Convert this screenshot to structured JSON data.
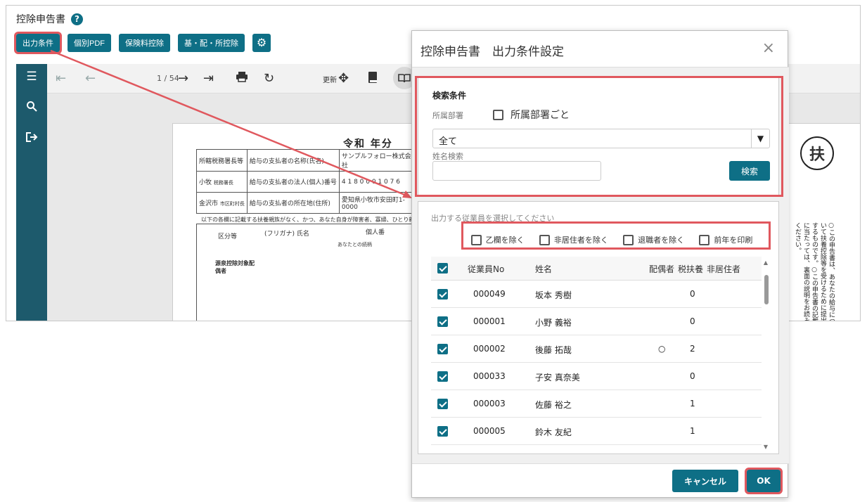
{
  "app": {
    "title": "控除申告書"
  },
  "toolbar": {
    "output_conditions": "出力条件",
    "individual_pdf": "個別PDF",
    "insurance_deduction": "保険料控除",
    "basic_spouse_deduction": "基・配・所控除"
  },
  "viewer": {
    "page_indicator": "1 / 54",
    "refresh_label": "更新"
  },
  "document": {
    "title": "令和 年分",
    "office_label": "所轄税務署長等",
    "tax_office": "小牧",
    "tax_office_suffix": "税務署長",
    "payer_name_label": "給与の支払者の名称(氏名)",
    "payer_name": "サンプルフォロー株式会社",
    "payer_number_label": "給与の支払者の法人(個人)番号",
    "payer_number": "4 1 8 0 0 0 1 0 7 6",
    "city": "金沢市",
    "city_suffix": "市区町村長",
    "payer_address_label": "給与の支払者の所在地(住所)",
    "payer_address": "愛知県小牧市安田町1-0000",
    "note": "以下の各欄に記載する扶養親族がなく、かつ、あなた自身が障害者、寡婦、ひとり親又",
    "class_label": "区分等",
    "furigana": "(フリガナ) 氏名",
    "personal_label": "個人番",
    "relation_label": "あなたとの続柄",
    "spouse_label": "源泉控除対象配偶者",
    "fu": "扶",
    "side_note": "○この申告書は、あなたの給与について扶養控除等を受けるために提出するものです。○この申告書の記載に当たっては、裏面の説明をお読みください。"
  },
  "dialog": {
    "title": "控除申告書　出力条件設定",
    "close": "×",
    "search": {
      "heading": "検索条件",
      "dept_label": "所属部署",
      "per_dept_label": "所属部署ごと",
      "per_dept_checked": false,
      "dept_value": "全て",
      "name_label": "姓名検索",
      "name_value": "",
      "search_button": "検索"
    },
    "list": {
      "hint": "出力する従業員を選択してください",
      "options": [
        {
          "label": "乙欄を除く",
          "checked": false
        },
        {
          "label": "非居住者を除く",
          "checked": false
        },
        {
          "label": "退職者を除く",
          "checked": false
        },
        {
          "label": "前年を印刷",
          "checked": false
        }
      ],
      "columns": {
        "no": "従業員No",
        "name": "姓名",
        "spouse": "配偶者",
        "dependents": "税扶養",
        "nonresident": "非居住者"
      },
      "rows": [
        {
          "no": "000049",
          "name": "坂本 秀樹",
          "spouse": "",
          "dependents": "0",
          "nonresident": ""
        },
        {
          "no": "000001",
          "name": "小野 義裕",
          "spouse": "",
          "dependents": "0",
          "nonresident": ""
        },
        {
          "no": "000002",
          "name": "後藤 拓哉",
          "spouse": "○",
          "dependents": "2",
          "nonresident": ""
        },
        {
          "no": "000033",
          "name": "子安 真奈美",
          "spouse": "",
          "dependents": "0",
          "nonresident": ""
        },
        {
          "no": "000003",
          "name": "佐藤 裕之",
          "spouse": "",
          "dependents": "1",
          "nonresident": ""
        },
        {
          "no": "000005",
          "name": "鈴木 友紀",
          "spouse": "",
          "dependents": "1",
          "nonresident": ""
        }
      ]
    },
    "cancel": "キャンセル",
    "ok": "OK"
  },
  "colors": {
    "primary": "#0e6f86",
    "sidebar": "#1d5a6c",
    "highlight": "#e0585e"
  },
  "icons": [
    "help-icon",
    "gear-icon",
    "menu-icon",
    "search-icon",
    "logout-icon",
    "first-page-icon",
    "prev-page-icon",
    "next-page-icon",
    "last-page-icon",
    "print-icon",
    "refresh-icon",
    "move-icon",
    "book-icon",
    "open-book-icon",
    "close-icon"
  ]
}
